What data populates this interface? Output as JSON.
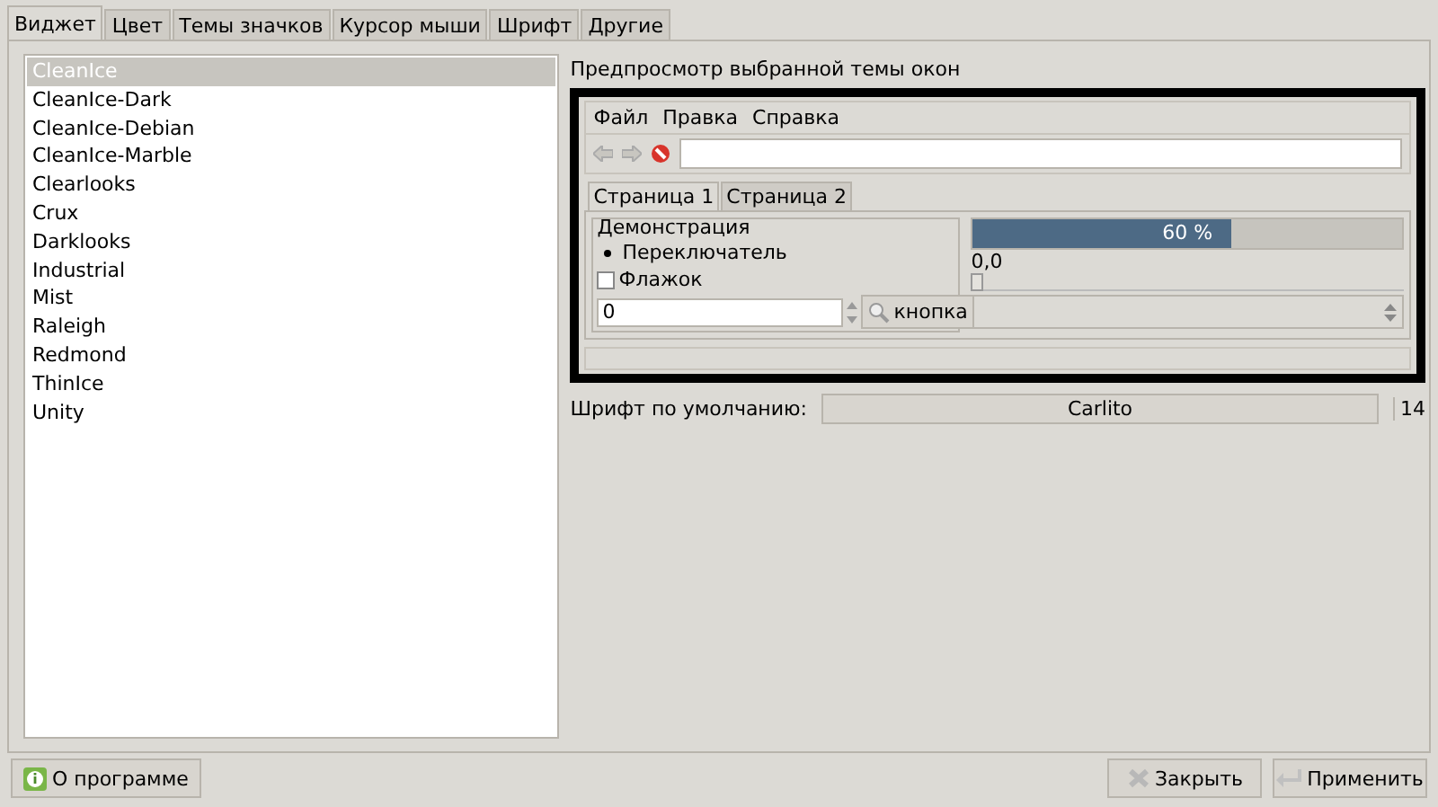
{
  "tabs": [
    {
      "label": "Виджет",
      "selected": true
    },
    {
      "label": "Цвет",
      "selected": false
    },
    {
      "label": "Темы значков",
      "selected": false
    },
    {
      "label": "Курсор мыши",
      "selected": false
    },
    {
      "label": "Шрифт",
      "selected": false
    },
    {
      "label": "Другие",
      "selected": false
    }
  ],
  "theme_list": [
    {
      "label": "CleanIce",
      "selected": true
    },
    {
      "label": "CleanIce-Dark",
      "selected": false
    },
    {
      "label": "CleanIce-Debian",
      "selected": false
    },
    {
      "label": "CleanIce-Marble",
      "selected": false
    },
    {
      "label": "Clearlooks",
      "selected": false
    },
    {
      "label": "Crux",
      "selected": false
    },
    {
      "label": "Darklooks",
      "selected": false
    },
    {
      "label": "Industrial",
      "selected": false
    },
    {
      "label": "Mist",
      "selected": false
    },
    {
      "label": "Raleigh",
      "selected": false
    },
    {
      "label": "Redmond",
      "selected": false
    },
    {
      "label": "ThinIce",
      "selected": false
    },
    {
      "label": "Unity",
      "selected": false
    }
  ],
  "preview": {
    "title": "Предпросмотр выбранной темы окон",
    "menu": [
      "Файл",
      "Правка",
      "Справка"
    ],
    "tabs": [
      {
        "label": "Страница 1",
        "selected": true
      },
      {
        "label": "Страница 2",
        "selected": false
      }
    ],
    "group_title": "Демонстрация",
    "radio": {
      "label": "Переключатель",
      "checked": true
    },
    "checkbox": {
      "label": "Флажок",
      "checked": false
    },
    "spin_value": "0",
    "button": "кнопка",
    "progress": {
      "level": 0.6,
      "reading": "60 %"
    },
    "slider": {
      "reading": "0,0",
      "level": 0
    }
  },
  "font": {
    "label": "Шрифт по умолчанию:",
    "name": "Carlito",
    "size": "14"
  },
  "buttons": {
    "about": "О программе",
    "close": "Закрыть",
    "apply": "Применить"
  }
}
